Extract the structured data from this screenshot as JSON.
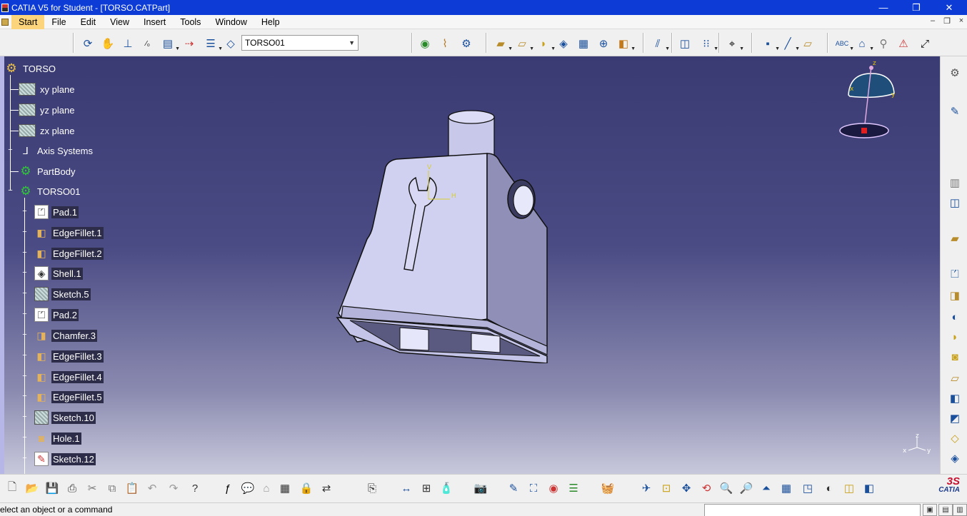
{
  "window": {
    "title": "CATIA V5 for Student - [TORSO.CATPart]",
    "min_label": "—",
    "max_label": "❐",
    "close_label": "✕"
  },
  "menubar": {
    "items": [
      "Start",
      "File",
      "Edit",
      "View",
      "Insert",
      "Tools",
      "Window",
      "Help"
    ],
    "doc_min": "–",
    "doc_restore": "❐",
    "doc_close": "×"
  },
  "toolbar": {
    "body_select_value": "TORSO01",
    "icons": [
      "update-icon",
      "fly-mode-icon",
      "axis-system-icon",
      "formula-icon",
      "parts-icon",
      "snap-icon",
      "sketch-selection-icon",
      "plane-icon",
      "apply-material-icon",
      "measure-icon",
      "catalog-icon",
      "pad-icon",
      "pocket-icon",
      "shaft-icon",
      "rib-icon",
      "multi-section-icon",
      "hole-icon",
      "fillet-icon",
      "draft-icon",
      "shell-icon",
      "pattern-icon",
      "grid-icon",
      "snap-point-icon",
      "point-icon",
      "line-icon",
      "plane-tool-icon",
      "text-icon",
      "annotation-icon",
      "constraint-icon",
      "analysis-icon",
      "transform-icon"
    ]
  },
  "tree": {
    "root": "TORSO",
    "items": [
      {
        "label": "xy plane",
        "icon": "plane-icon"
      },
      {
        "label": "yz plane",
        "icon": "plane-icon"
      },
      {
        "label": "zx plane",
        "icon": "plane-icon"
      },
      {
        "label": "Axis Systems",
        "icon": "axis-icon"
      },
      {
        "label": "PartBody",
        "icon": "gear-icon"
      },
      {
        "label": "TORSO01",
        "icon": "body-icon"
      }
    ],
    "features": [
      {
        "label": "Pad.1",
        "icon": "pad-icon"
      },
      {
        "label": "EdgeFillet.1",
        "icon": "fillet-icon"
      },
      {
        "label": "EdgeFillet.2",
        "icon": "fillet-icon"
      },
      {
        "label": "Shell.1",
        "icon": "shell-icon"
      },
      {
        "label": "Sketch.5",
        "icon": "sketch-icon"
      },
      {
        "label": "Pad.2",
        "icon": "pad-icon"
      },
      {
        "label": "Chamfer.3",
        "icon": "chamfer-icon"
      },
      {
        "label": "EdgeFillet.3",
        "icon": "fillet-icon"
      },
      {
        "label": "EdgeFillet.4",
        "icon": "fillet-icon"
      },
      {
        "label": "EdgeFillet.5",
        "icon": "fillet-icon"
      },
      {
        "label": "Sketch.10",
        "icon": "sketch-icon"
      },
      {
        "label": "Hole.1",
        "icon": "hole-icon"
      },
      {
        "label": "Sketch.12",
        "icon": "sketch-icon"
      }
    ]
  },
  "compass": {
    "x": "x",
    "y": "y",
    "z": "z"
  },
  "viewport_axes": {
    "x": "x",
    "y": "y",
    "z": "z"
  },
  "logo": {
    "mark": "3S",
    "text": "CATIA"
  },
  "status": {
    "text": "elect an object or a command"
  },
  "colors": {
    "title_bar": "#0c3bd6",
    "viewport_top": "#3b3b73",
    "viewport_bottom": "#c8c8dc",
    "part_face": "#d0d0f0",
    "active_menu": "#fbd47b",
    "tree_icon_green": "#32c43c"
  }
}
